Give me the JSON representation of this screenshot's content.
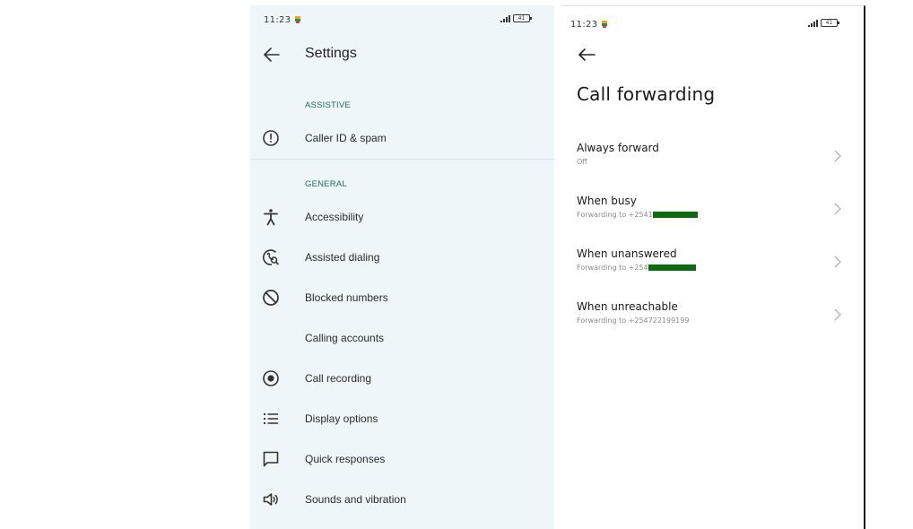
{
  "left_screen": {
    "status": {
      "time": "11:23",
      "battery": "41"
    },
    "title": "Settings",
    "sections": [
      {
        "header": "ASSISTIVE",
        "items": [
          {
            "label": "Caller ID & spam",
            "icon": "info-alert-icon"
          }
        ]
      },
      {
        "header": "GENERAL",
        "items": [
          {
            "label": "Accessibility",
            "icon": "accessibility-icon"
          },
          {
            "label": "Assisted dialing",
            "icon": "assisted-dialing-icon"
          },
          {
            "label": "Blocked numbers",
            "icon": "block-icon"
          },
          {
            "label": "Calling accounts",
            "icon": ""
          },
          {
            "label": "Call recording",
            "icon": "record-icon"
          },
          {
            "label": "Display options",
            "icon": "list-icon"
          },
          {
            "label": "Quick responses",
            "icon": "message-icon"
          },
          {
            "label": "Sounds and vibration",
            "icon": "speaker-icon"
          }
        ]
      }
    ]
  },
  "right_screen": {
    "status": {
      "time": "11:23",
      "battery": "41"
    },
    "title": "Call forwarding",
    "items": [
      {
        "title": "Always forward",
        "subtitle": "Off",
        "redacted": false
      },
      {
        "title": "When busy",
        "subtitle": "Forwarding to +2541",
        "redacted": true
      },
      {
        "title": "When unanswered",
        "subtitle": "Forwarding to +254",
        "redacted": true
      },
      {
        "title": "When unreachable",
        "subtitle": "Forwarding to +254722199199",
        "redacted": false
      }
    ]
  },
  "colors": {
    "settings_bg": "#eef6f9",
    "section_header": "#1a6a5f",
    "redaction": "#0f6b12"
  }
}
